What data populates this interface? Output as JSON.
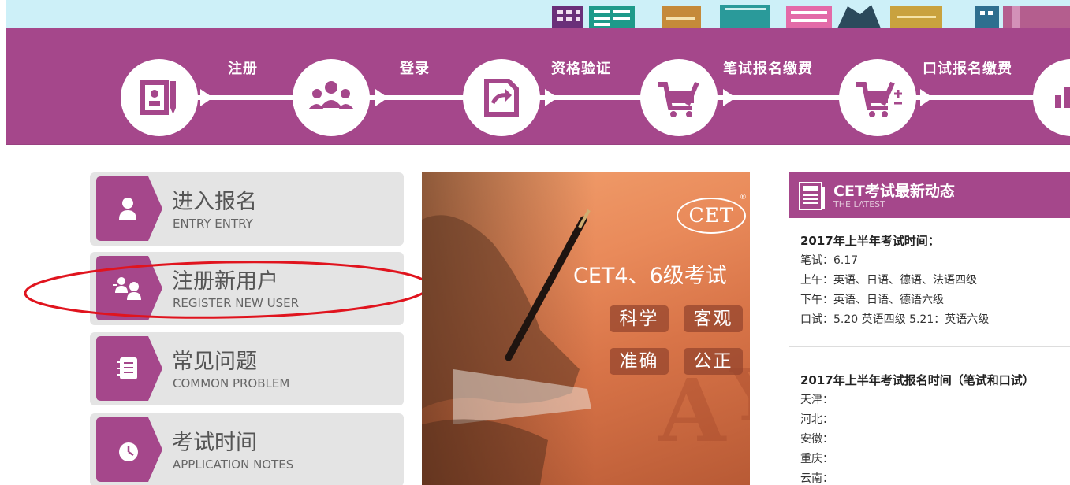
{
  "steps": [
    {
      "label": "注册",
      "icon": "register-form-icon"
    },
    {
      "label": "登录",
      "icon": "users-group-icon"
    },
    {
      "label": "资格验证",
      "icon": "verify-icon"
    },
    {
      "label": "笔试报名缴费",
      "icon": "cart-icon"
    },
    {
      "label": "口试报名缴费",
      "icon": "cart-plus-icon"
    }
  ],
  "menu": [
    {
      "cn": "进入报名",
      "en": "ENTRY ENTRY",
      "icon": "user-icon"
    },
    {
      "cn": "注册新用户",
      "en": "REGISTER NEW USER",
      "icon": "add-users-icon"
    },
    {
      "cn": "常见问题",
      "en": "COMMON PROBLEM",
      "icon": "notebook-icon"
    },
    {
      "cn": "考试时间",
      "en": "APPLICATION NOTES",
      "icon": "clock-icon"
    }
  ],
  "banner": {
    "logo": "CET",
    "title": "CET4、6级考试",
    "tags": [
      "科学",
      "客观",
      "准确",
      "公正"
    ]
  },
  "news": {
    "title": "CET考试最新动态",
    "subtitle": "THE LATEST",
    "block1": {
      "heading": "2017年上半年考试时间：",
      "lines": [
        "笔试：6.17",
        "上午：英语、日语、德语、法语四级",
        "下午：英语、日语、德语六级",
        "口试：5.20 英语四级   5.21：英语六级"
      ]
    },
    "block2": {
      "heading": "2017年上半年考试报名时间（笔试和口试）",
      "lines": [
        "天津：",
        "河北：",
        "安徽：",
        "重庆：",
        "云南："
      ]
    }
  },
  "colors": {
    "brand_purple": "#a5478b",
    "annotation_red": "#e0141e",
    "banner_orange": "#e98a5a"
  }
}
